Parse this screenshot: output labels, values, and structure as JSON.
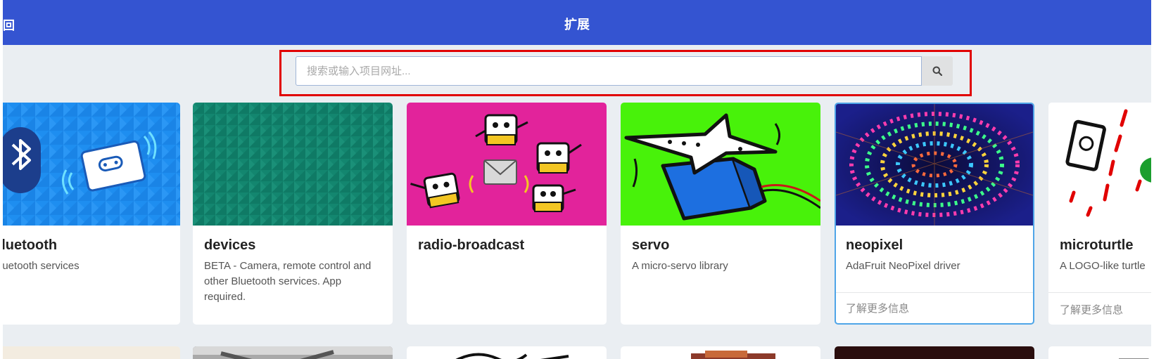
{
  "header": {
    "back_label": "回",
    "title": "扩展",
    "background_color": "#3454d1"
  },
  "search": {
    "placeholder": "搜索或输入项目网址...",
    "value": "",
    "button_icon": "search-icon",
    "highlight_color": "#e10000"
  },
  "cards": [
    {
      "title": "bluetooth",
      "description": "Bluetooth services",
      "footer": ""
    },
    {
      "title": "devices",
      "description": "BETA - Camera, remote control and other Bluetooth services. App required.",
      "footer": ""
    },
    {
      "title": "radio-broadcast",
      "description": "",
      "footer": ""
    },
    {
      "title": "servo",
      "description": "A micro-servo library",
      "footer": ""
    },
    {
      "title": "neopixel",
      "description": "AdaFruit NeoPixel driver",
      "footer": "了解更多信息",
      "selected": true
    },
    {
      "title": "microturtle",
      "description": "A LOGO-like turtle",
      "footer": "了解更多信息"
    }
  ]
}
